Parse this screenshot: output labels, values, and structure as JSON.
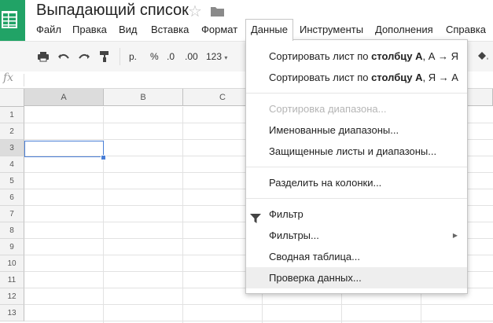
{
  "app": {
    "title": "Выпадающий список",
    "brand_color": "#21a366"
  },
  "menubar": {
    "items": [
      {
        "label": "Файл"
      },
      {
        "label": "Правка"
      },
      {
        "label": "Вид"
      },
      {
        "label": "Вставка"
      },
      {
        "label": "Формат"
      },
      {
        "label": "Данные"
      },
      {
        "label": "Инструменты"
      },
      {
        "label": "Дополнения"
      },
      {
        "label": "Справка"
      }
    ],
    "open_menu": "Данные"
  },
  "toolbar": {
    "currency": "р.",
    "percent": "%",
    "decrease_decimals": ".0",
    "increase_decimals": ".00",
    "number_format": "123"
  },
  "formula_bar": {
    "icon": "fx",
    "value": ""
  },
  "grid": {
    "columns": [
      "A",
      "B",
      "C"
    ],
    "rows": [
      "1",
      "2",
      "3",
      "4",
      "5",
      "6",
      "7",
      "8",
      "9",
      "10",
      "11",
      "12",
      "13"
    ],
    "selected_cell": "A3",
    "selection_color": "#4a7fd6"
  },
  "data_menu": {
    "sort_az_prefix": "Сортировать лист по ",
    "sort_az_bold": "столбцу А",
    "sort_az_suffix": ", А → Я",
    "sort_za_prefix": "Сортировать лист по ",
    "sort_za_bold": "столбцу А",
    "sort_za_suffix": ", Я → А",
    "sort_range": "Сортировка диапазона...",
    "named_ranges": "Именованные диапазоны...",
    "protected_sheets": "Защищенные листы и диапазоны...",
    "split_columns": "Разделить на колонки...",
    "filter": "Фильтр",
    "filter_views": "Фильтры...",
    "pivot_table": "Сводная таблица...",
    "data_validation": "Проверка данных..."
  }
}
